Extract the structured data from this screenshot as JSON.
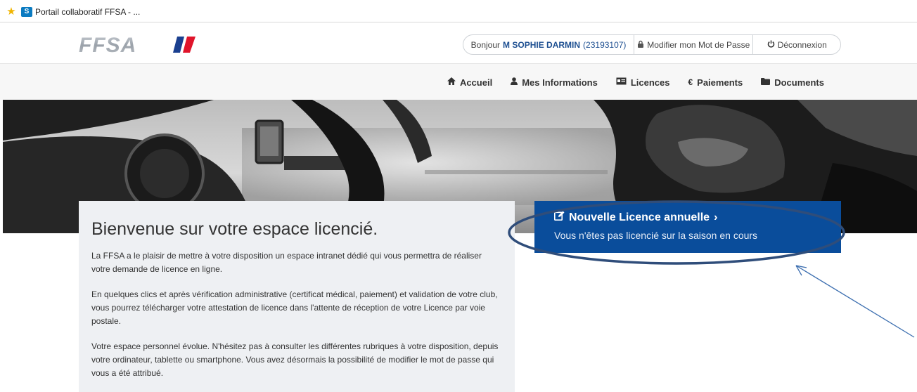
{
  "browser": {
    "tab_title": "Portail collaboratif FFSA - ...",
    "tab_icons": [
      "favorites-star-icon",
      "sharepoint-icon"
    ]
  },
  "header": {
    "logo_text": "FFSA",
    "user": {
      "greeting": "Bonjour",
      "name": "M SOPHIE DARMIN",
      "id": "(23193107)"
    },
    "change_password_label": "Modifier mon Mot de Passe",
    "logout_label": "Déconnexion"
  },
  "nav": {
    "items": [
      {
        "label": "Accueil",
        "icon": "home-icon"
      },
      {
        "label": "Mes Informations",
        "icon": "user-icon"
      },
      {
        "label": "Licences",
        "icon": "id-card-icon"
      },
      {
        "label": "Paiements",
        "icon": "euro-icon"
      },
      {
        "label": "Documents",
        "icon": "folder-icon"
      }
    ]
  },
  "welcome": {
    "title": "Bienvenue sur votre espace licencié.",
    "paragraphs": [
      "La FFSA a le plaisir de mettre à votre disposition un espace intranet dédié qui vous permettra de réaliser votre demande de licence en ligne.",
      "En quelques clics et après vérification administrative (certificat médical, paiement) et validation de votre club, vous pourrez télécharger votre attestation de licence dans l'attente de réception de votre Licence par voie postale.",
      "Votre espace personnel évolue. N'hésitez pas à consulter les différentes rubriques à votre disposition, depuis votre ordinateur, tablette ou smartphone. Vous avez désormais la possibilité de modifier le mot de passe qui vous a été attribué."
    ]
  },
  "cta": {
    "title": "Nouvelle Licence annuelle",
    "chevron": "›",
    "subtitle": "Vous n'êtes pas licencié sur la saison en cours"
  },
  "colors": {
    "brand_blue": "#0a4d9b",
    "name_blue": "#1d4f91",
    "annotation_blue": "#2f4d7a"
  }
}
